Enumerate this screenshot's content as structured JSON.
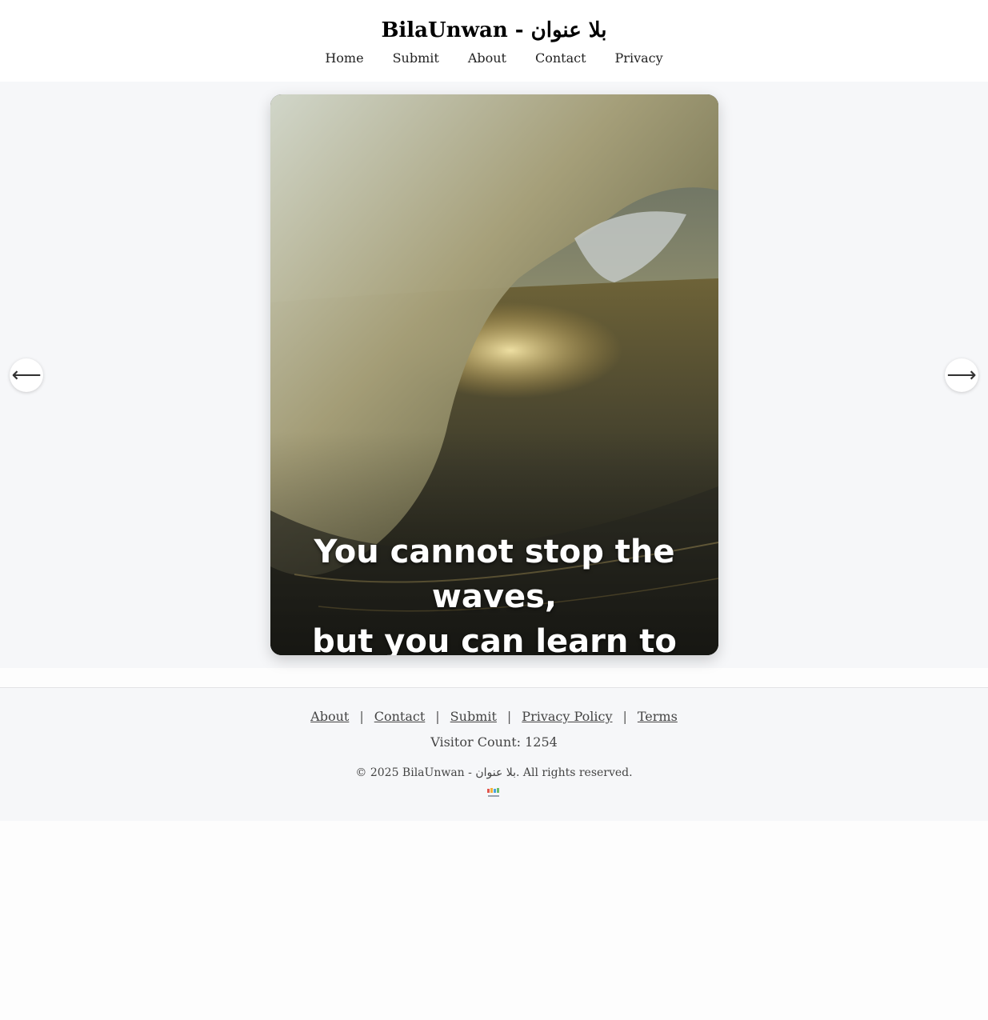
{
  "header": {
    "site_title": "BilaUnwan - بلا عنوان",
    "nav": [
      {
        "label": "Home"
      },
      {
        "label": "Submit"
      },
      {
        "label": "About"
      },
      {
        "label": "Contact"
      },
      {
        "label": "Privacy"
      }
    ]
  },
  "slider": {
    "quote_line1": "You cannot stop the waves,",
    "quote_line2": "but you can learn to surf.",
    "prev_icon": "arrow-left-icon",
    "next_icon": "arrow-right-icon",
    "prev_glyph": "⟵",
    "next_glyph": "⟶"
  },
  "footer": {
    "links": [
      {
        "label": "About"
      },
      {
        "label": "Contact"
      },
      {
        "label": "Submit"
      },
      {
        "label": "Privacy Policy"
      },
      {
        "label": "Terms"
      }
    ],
    "separator": "|",
    "visitor_count": "Visitor Count: 1254",
    "copyright": "© 2025 BilaUnwan - بلا عنوان. All rights reserved.",
    "logo_icon": "bilaunwan-logo-icon"
  },
  "colors": {
    "stage_bg": "#f6f7f9",
    "footer_bg": "#f6f7f9",
    "header_bg": "#ffffff"
  }
}
